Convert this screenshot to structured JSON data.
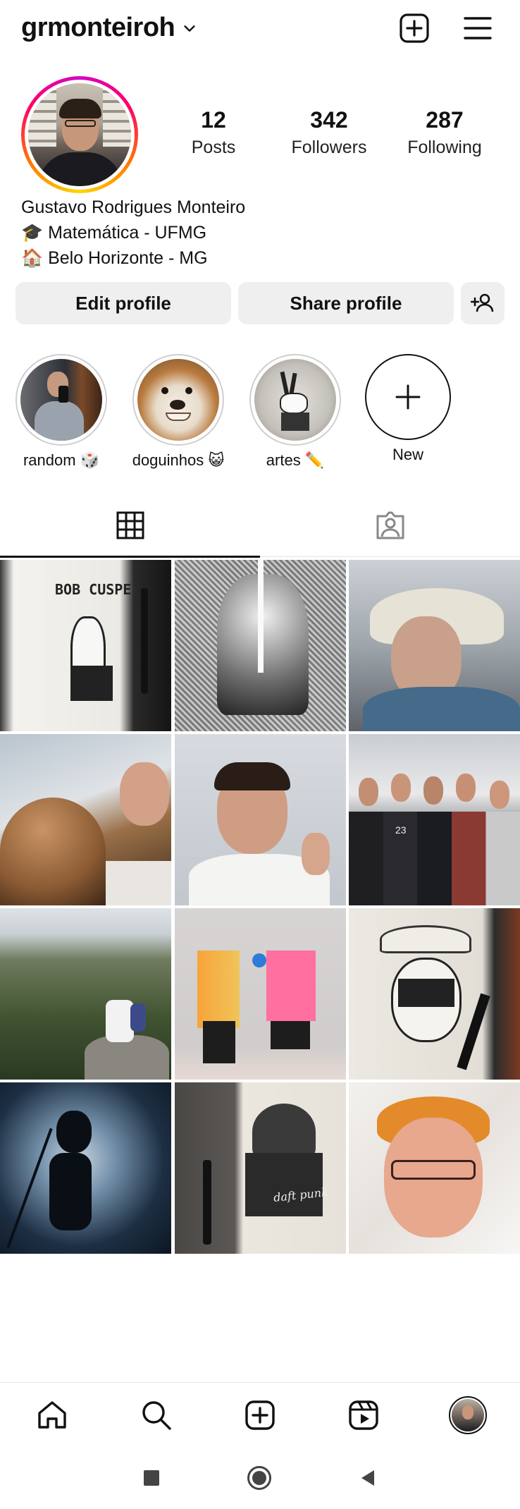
{
  "header": {
    "username": "grmonteiroh",
    "icons": {
      "chevron": "chevron-down-icon",
      "create": "plus-square-icon",
      "menu": "hamburger-menu-icon"
    }
  },
  "profile": {
    "stats": [
      {
        "value": "12",
        "label": "Posts"
      },
      {
        "value": "342",
        "label": "Followers"
      },
      {
        "value": "287",
        "label": "Following"
      }
    ],
    "bio": {
      "name": "Gustavo Rodrigues Monteiro",
      "line1": "🎓 Matemática - UFMG",
      "line2": "🏠 Belo Horizonte - MG"
    }
  },
  "actions": {
    "edit_profile": "Edit profile",
    "share_profile": "Share profile",
    "discover_icon": "add-person-icon"
  },
  "highlights": [
    {
      "label": "random 🎲"
    },
    {
      "label": "doguinhos 😺"
    },
    {
      "label": "artes ✏️"
    },
    {
      "label": "New"
    }
  ],
  "tabs": [
    {
      "name": "grid",
      "icon": "grid-icon",
      "active": true
    },
    {
      "name": "tagged",
      "icon": "tagged-person-icon",
      "active": false
    }
  ],
  "grid_posts": [
    {
      "label": "BOB CUSPE"
    },
    {
      "label": ""
    },
    {
      "label": ""
    },
    {
      "label": ""
    },
    {
      "label": ""
    },
    {
      "label": "23"
    },
    {
      "label": ""
    },
    {
      "label": ""
    },
    {
      "label": ""
    },
    {
      "label": ""
    },
    {
      "label": "daft punk"
    },
    {
      "label": ""
    }
  ],
  "bottom_nav": [
    "home-icon",
    "search-icon",
    "create-icon",
    "reels-icon",
    "profile-avatar"
  ],
  "system_nav": [
    "recents-square-icon",
    "home-circle-icon",
    "back-triangle-icon"
  ],
  "colors": {
    "button_bg": "#efefef",
    "text": "#111111",
    "ring_gradient": [
      "#d300c5",
      "#ff0069",
      "#ff7a00",
      "#ffd600"
    ]
  }
}
